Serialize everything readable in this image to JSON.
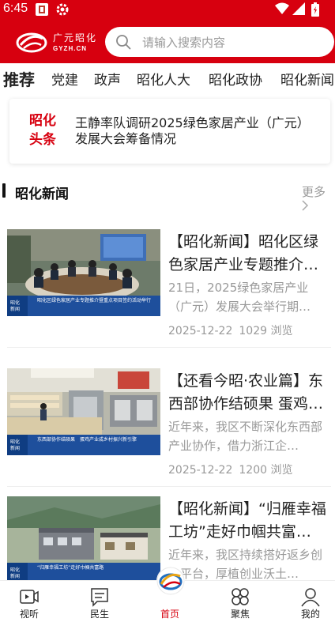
{
  "status": {
    "time": "6:45"
  },
  "header": {
    "logo_name": "广元昭化",
    "logo_domain": "GYZH.CN",
    "search_placeholder": "请输入搜索内容"
  },
  "tabs": [
    "推荐",
    "党建",
    "政声",
    "昭化人大",
    "昭化政协",
    "昭化新闻"
  ],
  "headline": {
    "badge_line1": "昭化",
    "badge_line2": "头条",
    "text": "王静率队调研2025绿色家居产业（广元）发展大会筹备情况"
  },
  "section": {
    "title": "昭化新闻",
    "more": "更多"
  },
  "news": [
    {
      "title": "【昭化新闻】昭化区绿色家居产业专题推介…",
      "summary": "21日，2025绿色家居产业（广元）发展大会举行期…",
      "date": "2025-12-22",
      "views": "1029 浏览",
      "caption": "昭化区绿色家居产业专题推介暨重点项目签约活动举行"
    },
    {
      "title": "【还看今昭·农业篇】东西部协作结硕果 蛋鸡…",
      "summary": "近年来，我区不断深化东西部产业协作，借力浙江企…",
      "date": "2025-12-22",
      "views": "1200 浏览",
      "caption": "东西部协作结硕果　蛋鸡产业成乡村振兴新引擎"
    },
    {
      "title": "【昭化新闻】“归雁幸福工坊”走好巾帼共富…",
      "summary": "近年来，我区持续搭好返乡创业平台，厚植创业沃土…",
      "date": "",
      "views": "",
      "caption": "“归雁幸福工坊”走好巾帼共富路"
    }
  ],
  "nav": [
    {
      "label": "视听",
      "icon": "video-icon"
    },
    {
      "label": "民生",
      "icon": "chat-icon"
    },
    {
      "label": "首页",
      "icon": "home-logo-icon"
    },
    {
      "label": "聚焦",
      "icon": "focus-icon"
    },
    {
      "label": "我的",
      "icon": "user-icon"
    }
  ],
  "colors": {
    "brand": "#d7000f",
    "muted": "#999999"
  }
}
